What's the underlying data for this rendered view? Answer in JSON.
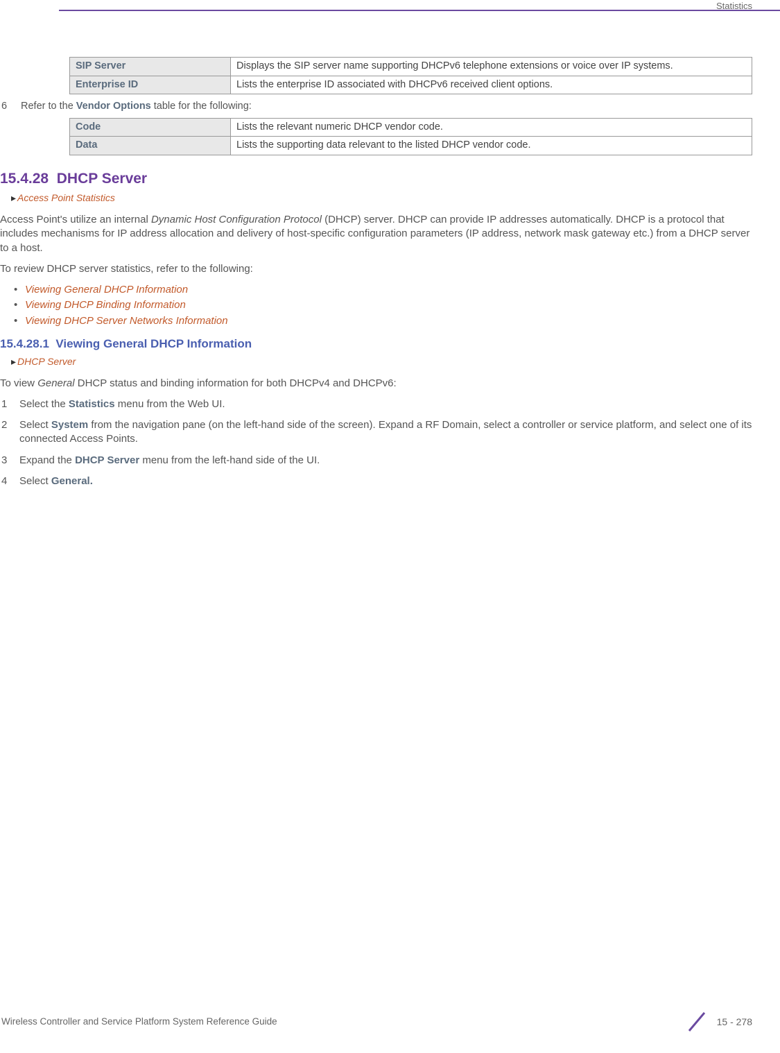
{
  "header": {
    "label": "Statistics"
  },
  "table1": {
    "rows": [
      {
        "term": "SIP Server",
        "desc": "Displays the SIP server name supporting DHCPv6 telephone extensions or voice over IP systems."
      },
      {
        "term": "Enterprise ID",
        "desc": "Lists the enterprise ID associated with DHCPv6 received client options."
      }
    ]
  },
  "step6": {
    "num": "6",
    "pre": "Refer to the ",
    "bold": "Vendor Options",
    "post": " table for the following:"
  },
  "table2": {
    "rows": [
      {
        "term": "Code",
        "desc": "Lists the relevant numeric DHCP vendor code."
      },
      {
        "term": "Data",
        "desc": "Lists the supporting data relevant to the listed DHCP vendor code."
      }
    ]
  },
  "section": {
    "num": "15.4.28",
    "title": "DHCP Server",
    "breadcrumb": "Access Point Statistics"
  },
  "para1": {
    "pre": "Access Point's utilize an internal ",
    "italic": "Dynamic Host Configuration Protocol",
    "post": " (DHCP) server. DHCP can provide IP addresses automatically. DHCP is a protocol that includes mechanisms for IP address allocation and delivery of host-specific configuration parameters (IP address, network mask gateway etc.) from a DHCP server to a host."
  },
  "para2": "To review DHCP server statistics, refer to the following:",
  "links": [
    "Viewing General DHCP Information",
    "Viewing DHCP Binding Information",
    "Viewing DHCP Server Networks Information"
  ],
  "subsection": {
    "num": "15.4.28.1",
    "title": "Viewing General DHCP Information",
    "breadcrumb": "DHCP Server"
  },
  "para3": {
    "pre": "To view ",
    "italic": "General",
    "post": " DHCP status and binding information for both DHCPv4 and DHCPv6:"
  },
  "steps": [
    {
      "n": "1",
      "parts": [
        {
          "t": "Select the "
        },
        {
          "b": "Statistics"
        },
        {
          "t": " menu from the Web UI."
        }
      ]
    },
    {
      "n": "2",
      "parts": [
        {
          "t": "Select "
        },
        {
          "b": "System"
        },
        {
          "t": " from the navigation pane (on the left-hand side of the screen). Expand a RF Domain, select a controller or service platform, and select one of its connected Access Points."
        }
      ]
    },
    {
      "n": "3",
      "parts": [
        {
          "t": "Expand the "
        },
        {
          "b": "DHCP Server"
        },
        {
          "t": " menu from the left-hand side of the UI."
        }
      ]
    },
    {
      "n": "4",
      "parts": [
        {
          "t": "Select "
        },
        {
          "b": "General."
        }
      ]
    }
  ],
  "footer": {
    "left": "Wireless Controller and Service Platform System Reference Guide",
    "page": "15 - 278"
  }
}
